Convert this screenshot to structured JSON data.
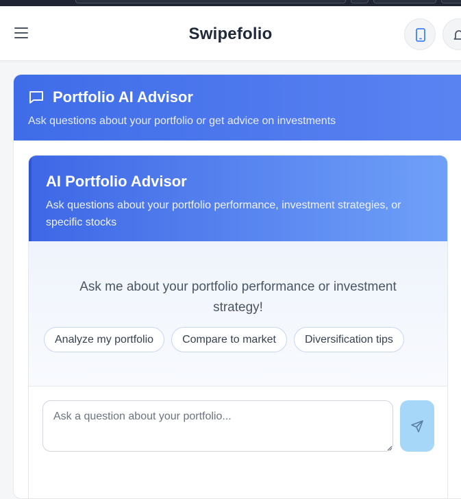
{
  "app": {
    "title": "Swipefolio"
  },
  "header": {
    "menu_icon": "hamburger-menu-icon",
    "device_icon": "mobile-device-icon",
    "bell_icon": "bell-icon"
  },
  "advisor_panel": {
    "title": "Portfolio AI Advisor",
    "subtitle": "Ask questions about your portfolio or get advice on investments",
    "icon": "chat-bubble-icon"
  },
  "chat_card": {
    "title": "AI Portfolio Advisor",
    "subtitle": "Ask questions about your portfolio performance, investment strategies, or specific stocks",
    "prompt": "Ask me about your portfolio performance or investment strategy!",
    "suggestions": [
      "Analyze my portfolio",
      "Compare to market",
      "Diversification tips"
    ],
    "input_placeholder": "Ask a question about your portfolio...",
    "send_icon": "send-icon"
  },
  "colors": {
    "header_gradient_start": "#3f6ce8",
    "header_gradient_end": "#5b84f2",
    "inner_gradient_end": "#6fa0f8",
    "send_button": "#a6d6f8"
  }
}
